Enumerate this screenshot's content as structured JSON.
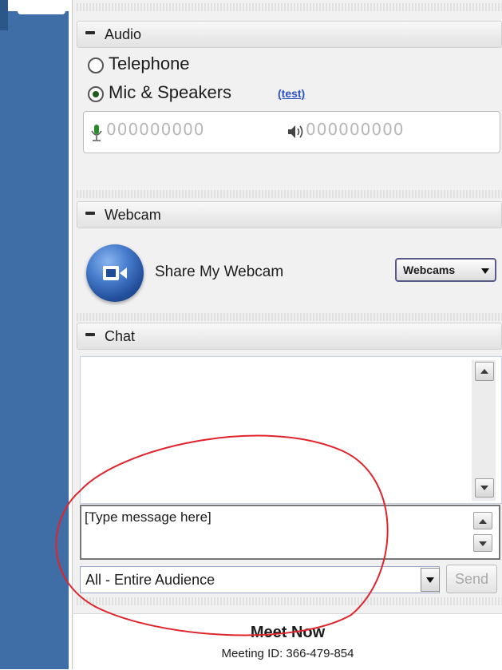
{
  "audio": {
    "title": "Audio",
    "options": [
      {
        "label": "Telephone",
        "selected": false
      },
      {
        "label": "Mic & Speakers",
        "selected": true
      }
    ],
    "test_link": "(test)",
    "mic_level_text": "000000000",
    "speaker_level_text": "000000000"
  },
  "webcam": {
    "title": "Webcam",
    "share_label": "Share My Webcam",
    "dropdown_label": "Webcams"
  },
  "chat": {
    "title": "Chat",
    "message_placeholder": "[Type message here]",
    "audience_value": "All - Entire Audience",
    "send_label": "Send"
  },
  "footer": {
    "title": "Meet Now",
    "meeting_id_text": "Meeting ID: 366-479-854"
  },
  "colors": {
    "left_bar": "#3f6ea6",
    "annotation_circle": "#e0242c",
    "link": "#2d52c8"
  }
}
